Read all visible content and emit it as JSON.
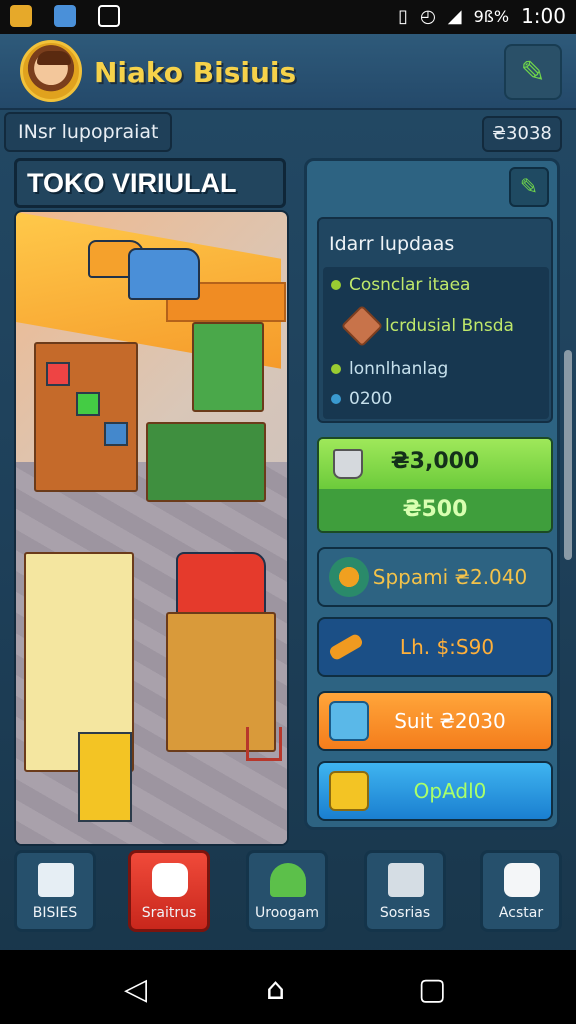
{
  "status_bar": {
    "time": "1:00",
    "battery": "9ß%"
  },
  "header": {
    "title": "Niako Bisiuis",
    "edit_icon": "pencil-icon"
  },
  "subbar": {
    "label": "INsr lupopraiat",
    "coins": "₴3038"
  },
  "store": {
    "title": "TOKO VIRIULAL"
  },
  "info": {
    "title": "Idarr lupdaas",
    "rows": [
      {
        "text": "Cosnclar itaea",
        "dot": "#9acd32",
        "color": "#bfe86a"
      },
      {
        "text": "lcrdusial Bnsda",
        "dot": "",
        "color": "#bfe86a"
      },
      {
        "text": "lonnlhanlag",
        "dot": "#9acd32",
        "color": "#c6e0ec"
      },
      {
        "text": "0200",
        "dot": "#3a9ad0",
        "color": "#c6e0ec"
      }
    ]
  },
  "price_card": {
    "main": "₴3,000",
    "sub": "₴500"
  },
  "actions": [
    {
      "label": "Sppami ₴2.040",
      "color": "#f3c24a"
    },
    {
      "label": "Lh. $:S90",
      "color": "#ffb03a"
    },
    {
      "label": "Suit ₴2030",
      "color": "#ffffff"
    },
    {
      "label": "OpAdl0",
      "color": "#a9ff6a"
    }
  ],
  "nav": [
    {
      "label": "BISIES"
    },
    {
      "label": "Sraitrus"
    },
    {
      "label": "Uroogam"
    },
    {
      "label": "Sosrias"
    },
    {
      "label": "Acstar"
    }
  ]
}
